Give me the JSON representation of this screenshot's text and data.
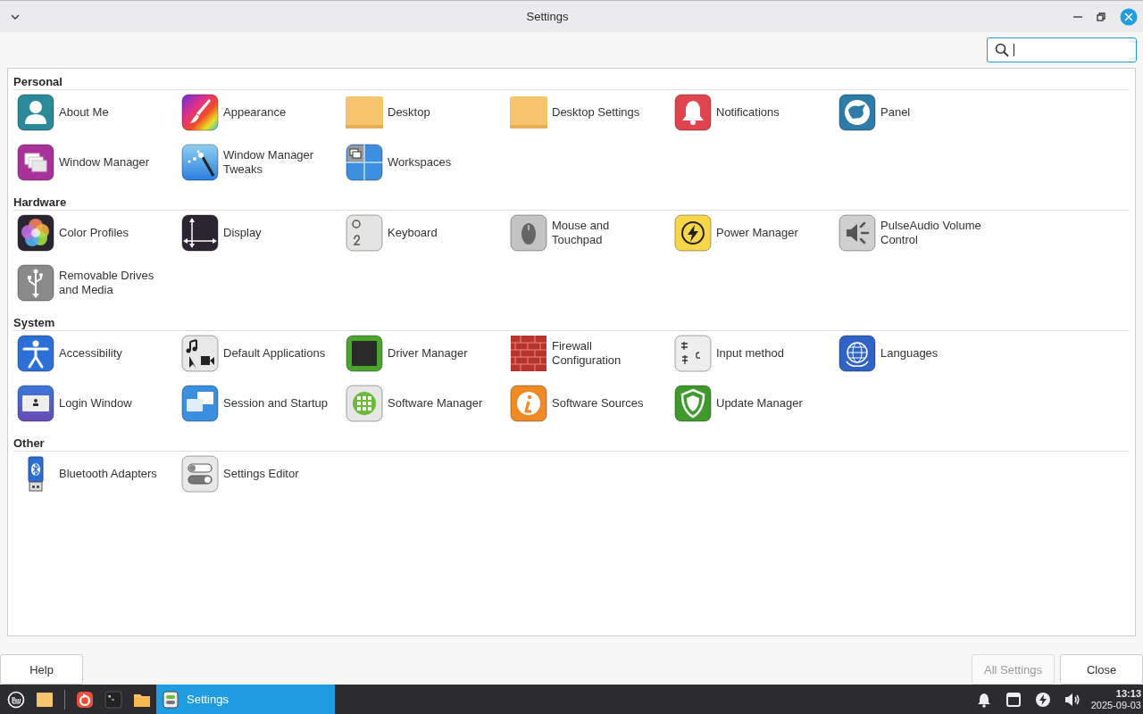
{
  "window": {
    "title": "Settings"
  },
  "search": {
    "focused": true
  },
  "sections": [
    {
      "title": "Personal",
      "items": [
        {
          "label": "About Me",
          "kind": "person"
        },
        {
          "label": "Appearance",
          "kind": "brush"
        },
        {
          "label": "Desktop",
          "kind": "folder"
        },
        {
          "label": "Desktop Settings",
          "kind": "folder"
        },
        {
          "label": "Notifications",
          "kind": "bell"
        },
        {
          "label": "Panel",
          "kind": "mascot"
        },
        {
          "label": "Window Manager",
          "kind": "windows"
        },
        {
          "label": "Window Manager Tweaks",
          "kind": "wand"
        },
        {
          "label": "Workspaces",
          "kind": "workspaces"
        }
      ]
    },
    {
      "title": "Hardware",
      "items": [
        {
          "label": "Color Profiles",
          "kind": "flower"
        },
        {
          "label": "Display",
          "kind": "axes"
        },
        {
          "label": "Keyboard",
          "kind": "key"
        },
        {
          "label": "Mouse and Touchpad",
          "kind": "mouse"
        },
        {
          "label": "Power Manager",
          "kind": "power"
        },
        {
          "label": "PulseAudio Volume Control",
          "kind": "speaker"
        },
        {
          "label": "Removable Drives and Media",
          "kind": "usb"
        }
      ]
    },
    {
      "title": "System",
      "items": [
        {
          "label": "Accessibility",
          "kind": "access"
        },
        {
          "label": "Default Applications",
          "kind": "media"
        },
        {
          "label": "Driver Manager",
          "kind": "chip"
        },
        {
          "label": "Firewall Configuration",
          "kind": "brick"
        },
        {
          "label": "Input method",
          "kind": "input"
        },
        {
          "label": "Languages",
          "kind": "globe"
        },
        {
          "label": "Login Window",
          "kind": "login"
        },
        {
          "label": "Session and Startup",
          "kind": "session"
        },
        {
          "label": "Software Manager",
          "kind": "apps"
        },
        {
          "label": "Software Sources",
          "kind": "info"
        },
        {
          "label": "Update Manager",
          "kind": "shield"
        }
      ]
    },
    {
      "title": "Other",
      "items": [
        {
          "label": "Bluetooth Adapters",
          "kind": "bluetooth"
        },
        {
          "label": "Settings Editor",
          "kind": "toggles"
        }
      ]
    }
  ],
  "buttons": [
    {
      "label": "Help",
      "disabled": false
    },
    {
      "label": "All Settings",
      "disabled": true
    },
    {
      "label": "Close",
      "disabled": false
    }
  ],
  "taskbar": {
    "launchers": [
      {
        "kind": "menu"
      },
      {
        "kind": "files"
      },
      {
        "kind": "separator"
      },
      {
        "kind": "app"
      },
      {
        "kind": "terminal"
      },
      {
        "kind": "folder"
      }
    ],
    "tasks": [
      {
        "label": "Settings",
        "selected": true
      }
    ],
    "tray": [
      {
        "kind": "bell"
      },
      {
        "kind": "window"
      },
      {
        "kind": "power"
      },
      {
        "kind": "volume"
      }
    ],
    "clock": {
      "time": "13:13",
      "date": "2025-09-03"
    }
  }
}
